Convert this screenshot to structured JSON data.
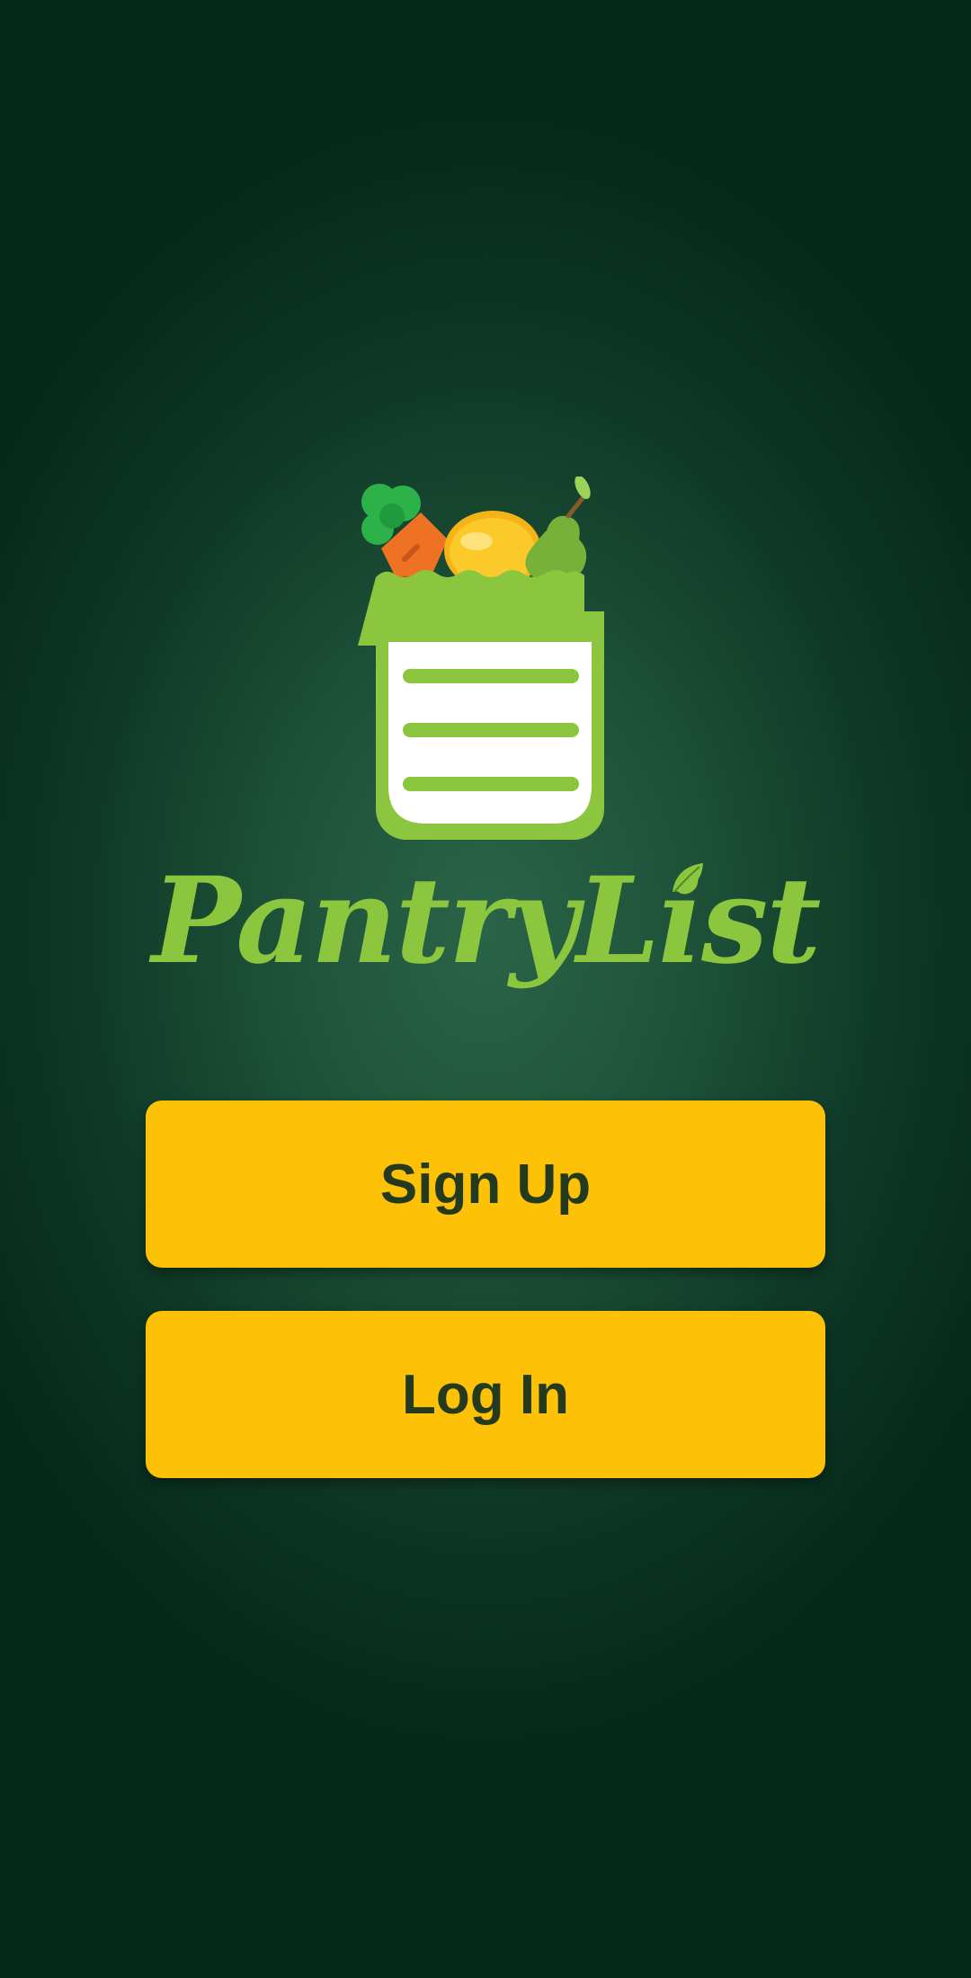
{
  "app": {
    "name": "PantryList"
  },
  "actions": {
    "signup_label": "Sign Up",
    "login_label": "Log In"
  },
  "colors": {
    "background": "#0f3826",
    "accent_green": "#8cc63f",
    "button_yellow": "#fdc107",
    "button_text": "#243a1c"
  },
  "icons": [
    "grocery-bag-list-icon",
    "carrot-icon",
    "lemon-icon",
    "pear-icon",
    "leaf-icon"
  ]
}
